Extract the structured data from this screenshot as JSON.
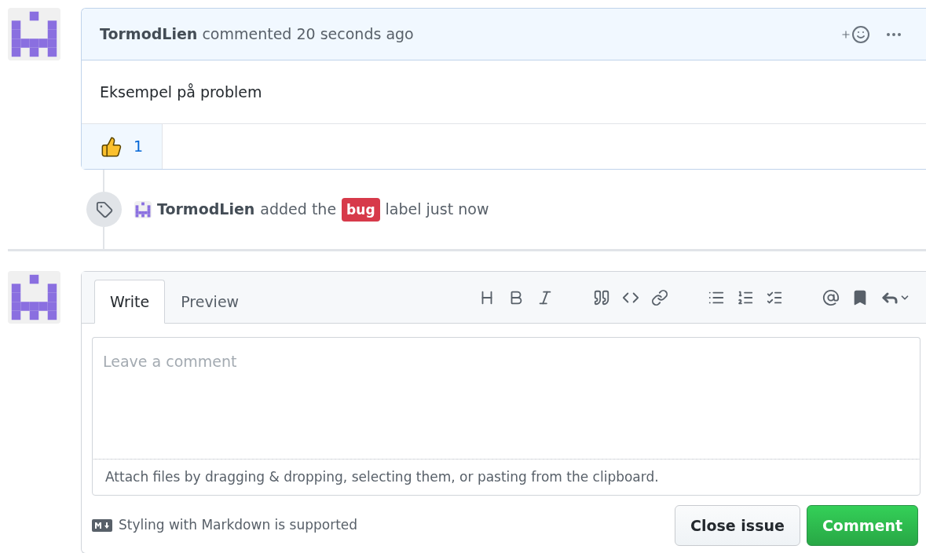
{
  "comment": {
    "author": "TormodLien",
    "action": "commented 20 seconds ago",
    "body": "Eksempel på problem",
    "reactions": [
      {
        "count": "1",
        "selected": true
      }
    ]
  },
  "event": {
    "author": "TormodLien",
    "before": "added the",
    "label": {
      "name": "bug",
      "color": "#d73a4a"
    },
    "after": "label just now"
  },
  "editor": {
    "tabs": [
      {
        "label": "Write",
        "selected": true
      },
      {
        "label": "Preview",
        "selected": false
      }
    ],
    "placeholder": "Leave a comment",
    "attach_hint": "Attach files by dragging & dropping, selecting them, or pasting from the clipboard.",
    "markdown_note": "Styling with Markdown is supported",
    "buttons": [
      {
        "label": "Close issue",
        "kind": "secondary"
      },
      {
        "label": "Comment",
        "kind": "primary"
      }
    ]
  }
}
